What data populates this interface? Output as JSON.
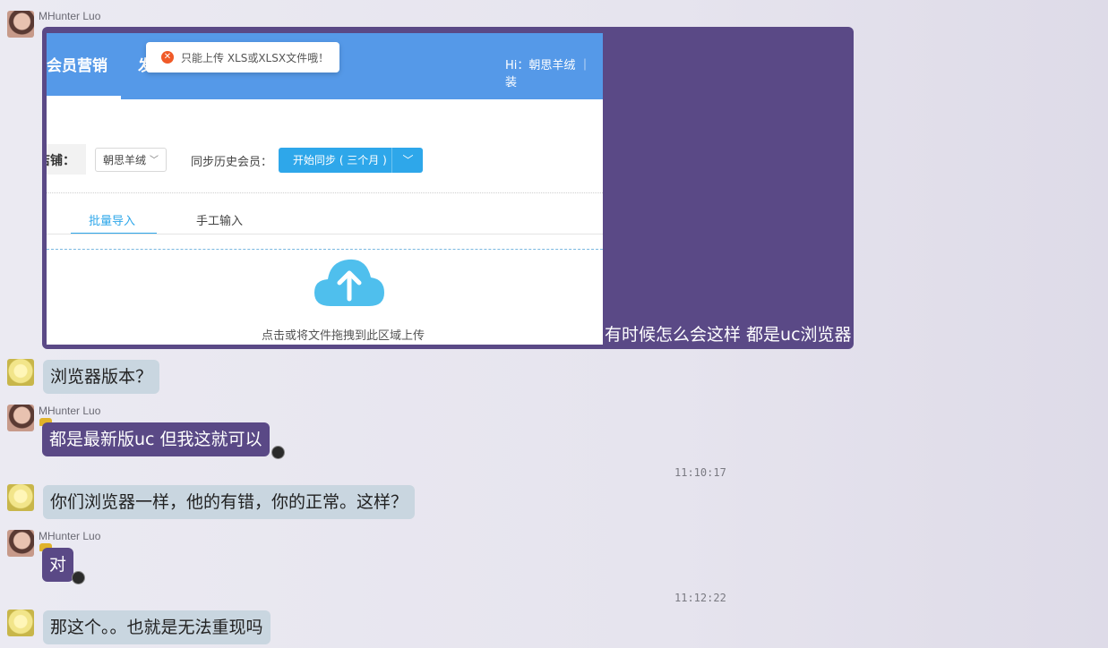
{
  "messages": {
    "m1": {
      "sender": "MHunter Luo",
      "caption": "有时候怎么会这样 都是uc浏览器",
      "screenshot": {
        "nav_title": "会员营销",
        "nav_title2": "发",
        "hi_text": "Hi：朝思羊绒 ｜ 装",
        "toast_text": "只能上传 XLS或XLSX文件哦！",
        "shop_label": "店铺：",
        "shop_select": "朝思羊绒",
        "sync_label": "同步历史会员：",
        "sync_button": "开始同步 ( 三个月 )",
        "tab_batch": "批量导入",
        "tab_manual": "手工输入",
        "upload_hint": "点击或将文件拖拽到此区域上传"
      }
    },
    "m2": {
      "text": "浏览器版本？"
    },
    "m3": {
      "sender": "MHunter Luo",
      "text": "都是最新版uc  但我这就可以"
    },
    "t1": "11:10:17",
    "m4": {
      "text": "你们浏览器一样，他的有错，你的正常。这样？"
    },
    "m5": {
      "sender": "MHunter Luo",
      "text": "对"
    },
    "t2": "11:12:22",
    "m6": {
      "text": "那这个。。也就是无法重现吗"
    }
  }
}
